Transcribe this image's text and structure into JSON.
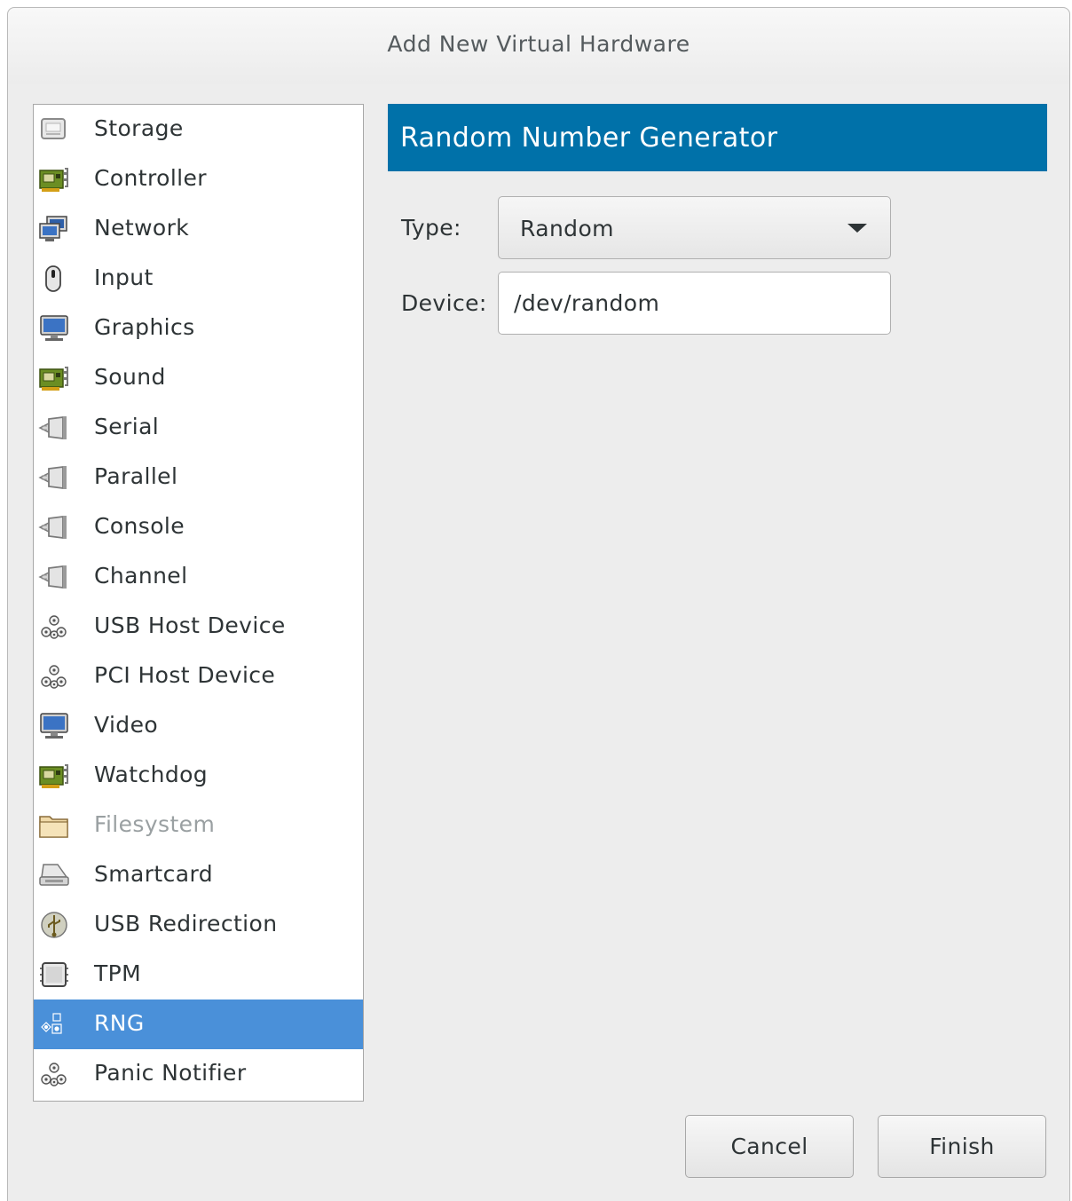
{
  "dialog": {
    "title": "Add New Virtual Hardware"
  },
  "hardware_list": {
    "items": [
      {
        "label": "Storage",
        "icon": "storage-icon"
      },
      {
        "label": "Controller",
        "icon": "controller-icon"
      },
      {
        "label": "Network",
        "icon": "network-icon"
      },
      {
        "label": "Input",
        "icon": "mouse-icon"
      },
      {
        "label": "Graphics",
        "icon": "monitor-icon"
      },
      {
        "label": "Sound",
        "icon": "sound-card-icon"
      },
      {
        "label": "Serial",
        "icon": "serial-icon"
      },
      {
        "label": "Parallel",
        "icon": "parallel-icon"
      },
      {
        "label": "Console",
        "icon": "console-icon"
      },
      {
        "label": "Channel",
        "icon": "channel-icon"
      },
      {
        "label": "USB Host Device",
        "icon": "usb-host-device-icon"
      },
      {
        "label": "PCI Host Device",
        "icon": "pci-host-device-icon"
      },
      {
        "label": "Video",
        "icon": "video-icon"
      },
      {
        "label": "Watchdog",
        "icon": "watchdog-icon"
      },
      {
        "label": "Filesystem",
        "icon": "folder-icon",
        "disabled": true
      },
      {
        "label": "Smartcard",
        "icon": "smartcard-icon"
      },
      {
        "label": "USB Redirection",
        "icon": "usb-redirection-icon"
      },
      {
        "label": "TPM",
        "icon": "tpm-chip-icon"
      },
      {
        "label": "RNG",
        "icon": "rng-icon",
        "selected": true
      },
      {
        "label": "Panic Notifier",
        "icon": "panic-notifier-icon"
      }
    ]
  },
  "details": {
    "header": "Random Number Generator",
    "type_label": "Type:",
    "type_value": "Random",
    "device_label": "Device:",
    "device_value": "/dev/random"
  },
  "buttons": {
    "cancel": "Cancel",
    "finish": "Finish"
  },
  "colors": {
    "header_bg": "#0071a9",
    "selection_bg": "#4a90d9",
    "dialog_bg": "#ededed"
  }
}
